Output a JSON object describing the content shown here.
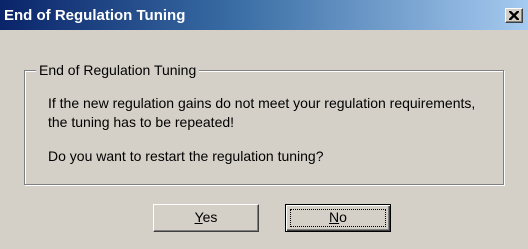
{
  "window": {
    "title": "End of Regulation Tuning",
    "close_glyph": "×"
  },
  "group": {
    "label": "End of Regulation Tuning"
  },
  "message": {
    "line1": "If the new regulation gains do not meet your regulation requirements,",
    "line2": "the tuning has to be repeated!",
    "line3": "Do you want to restart the regulation tuning?"
  },
  "buttons": {
    "yes": {
      "accel": "Y",
      "rest": "es"
    },
    "no": {
      "accel": "N",
      "rest": "o"
    }
  },
  "colors": {
    "title_start": "#0a246a",
    "title_end": "#a6caf0",
    "face": "#d4d0c8"
  },
  "icons": {
    "close": "close-icon"
  }
}
